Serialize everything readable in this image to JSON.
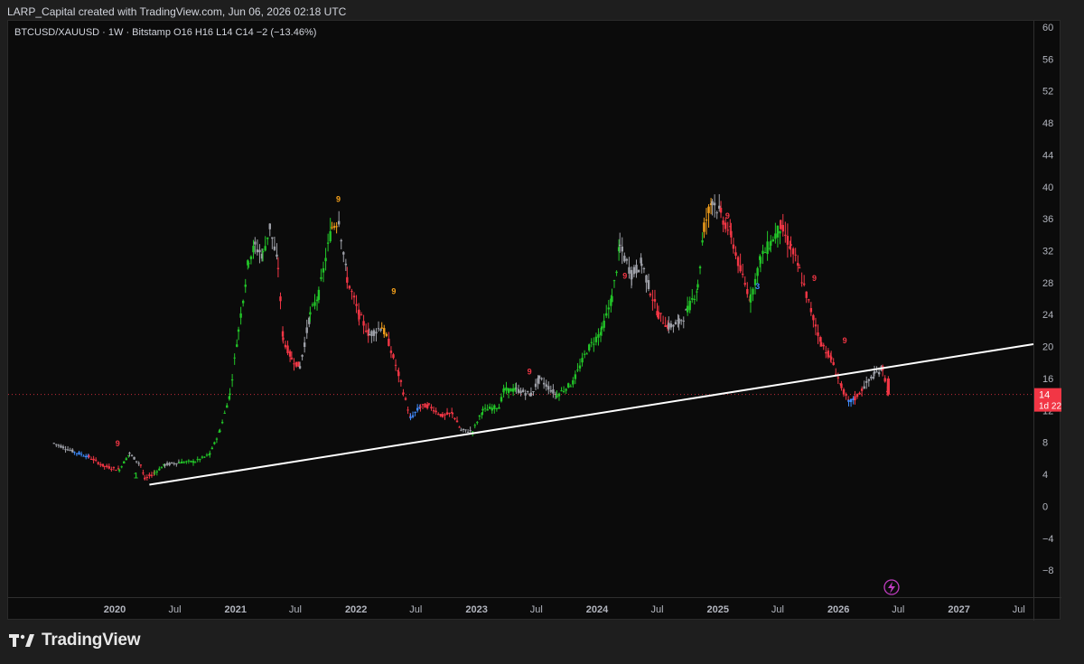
{
  "header": {
    "attribution": "LARP_Capital created with TradingView.com, Jun 06, 2026 02:18 UTC"
  },
  "symbol_line": "BTCUSD/XAUUSD · 1W · Bitstamp  O16  H16  L14  C14  −2 (−13.46%)",
  "brand": {
    "logo_icon": "tradingview-logo-icon",
    "name": "TradingView"
  },
  "price_badge": {
    "price": "14",
    "countdown": "1d 22h",
    "color": "#f23645"
  },
  "colors": {
    "background": "#0b0b0b",
    "up": "#22c528",
    "down": "#f23645",
    "neutral": "#9ea0a8",
    "blue": "#3d8bfd",
    "orange": "#f7a21b",
    "trendline": "#ffffff",
    "price_line": "#f23645"
  },
  "flash_icon": "lightning-icon",
  "chart_data": {
    "type": "candlestick",
    "title": "",
    "symbol": "BTCUSD/XAUUSD",
    "interval": "1W",
    "exchange": "Bitstamp",
    "y_axis": {
      "ylim": [
        -12,
        61
      ],
      "ticks": [
        "60",
        "56",
        "52",
        "48",
        "44",
        "40",
        "36",
        "32",
        "28",
        "24",
        "20",
        "16",
        "12",
        "8",
        "4",
        "0",
        "−4",
        "−8"
      ],
      "position": "right"
    },
    "x_axis": {
      "range": [
        "2019-04-01",
        "2027-08-01"
      ],
      "ticks": [
        {
          "label": "2020",
          "date": "2020-01-01",
          "bold": true
        },
        {
          "label": "Jul",
          "date": "2020-07-01",
          "bold": false
        },
        {
          "label": "2021",
          "date": "2021-01-01",
          "bold": true
        },
        {
          "label": "Jul",
          "date": "2021-07-01",
          "bold": false
        },
        {
          "label": "2022",
          "date": "2022-01-01",
          "bold": true
        },
        {
          "label": "Jul",
          "date": "2022-07-01",
          "bold": false
        },
        {
          "label": "2023",
          "date": "2023-01-01",
          "bold": true
        },
        {
          "label": "Jul",
          "date": "2023-07-01",
          "bold": false
        },
        {
          "label": "2024",
          "date": "2024-01-01",
          "bold": true
        },
        {
          "label": "Jul",
          "date": "2024-07-01",
          "bold": false
        },
        {
          "label": "2025",
          "date": "2025-01-01",
          "bold": true
        },
        {
          "label": "Jul",
          "date": "2025-07-01",
          "bold": false
        },
        {
          "label": "2026",
          "date": "2026-01-01",
          "bold": true
        },
        {
          "label": "Jul",
          "date": "2026-07-01",
          "bold": false
        },
        {
          "label": "2027",
          "date": "2027-01-01",
          "bold": true
        },
        {
          "label": "Jul",
          "date": "2027-07-01",
          "bold": false
        }
      ]
    },
    "trendline": {
      "start": [
        "2020-04-15",
        2.7
      ],
      "end": [
        "2027-08-01",
        20.3
      ]
    },
    "current_price": 14,
    "price_path": [
      [
        "2019-07-01",
        7.9,
        "neutral"
      ],
      [
        "2019-09-01",
        6.8,
        "neutral"
      ],
      [
        "2019-10-15",
        6.2,
        "blue"
      ],
      [
        "2019-12-01",
        5.0,
        "down"
      ],
      [
        "2020-01-15",
        4.6,
        "down"
      ],
      [
        "2020-02-15",
        6.6,
        "up"
      ],
      [
        "2020-03-20",
        5.2,
        "neutral"
      ],
      [
        "2020-04-01",
        3.4,
        "down"
      ],
      [
        "2020-05-01",
        4.2,
        "down"
      ],
      [
        "2020-06-01",
        5.2,
        "up"
      ],
      [
        "2020-07-15",
        5.5,
        "neutral"
      ],
      [
        "2020-09-01",
        5.6,
        "up"
      ],
      [
        "2020-10-15",
        6.5,
        "up"
      ],
      [
        "2020-11-15",
        9.5,
        "up"
      ],
      [
        "2020-12-15",
        14.0,
        "up"
      ],
      [
        "2021-01-10",
        22.0,
        "up"
      ],
      [
        "2021-02-10",
        31.0,
        "up"
      ],
      [
        "2021-03-01",
        32.5,
        "up"
      ],
      [
        "2021-03-25",
        31.5,
        "neutral"
      ],
      [
        "2021-04-15",
        35.0,
        "up"
      ],
      [
        "2021-05-10",
        30.0,
        "neutral"
      ],
      [
        "2021-05-25",
        21.0,
        "down"
      ],
      [
        "2021-06-20",
        18.5,
        "down"
      ],
      [
        "2021-07-15",
        17.5,
        "down"
      ],
      [
        "2021-08-15",
        24.0,
        "neutral"
      ],
      [
        "2021-09-10",
        26.5,
        "up"
      ],
      [
        "2021-10-01",
        31.0,
        "up"
      ],
      [
        "2021-10-20",
        35.0,
        "up"
      ],
      [
        "2021-11-10",
        36.0,
        "orange"
      ],
      [
        "2021-12-05",
        28.5,
        "neutral"
      ],
      [
        "2022-01-10",
        24.0,
        "down"
      ],
      [
        "2022-02-10",
        21.5,
        "down"
      ],
      [
        "2022-03-20",
        22.5,
        "neutral"
      ],
      [
        "2022-04-10",
        20.5,
        "orange"
      ],
      [
        "2022-05-10",
        16.5,
        "down"
      ],
      [
        "2022-06-15",
        11.0,
        "down"
      ],
      [
        "2022-07-15",
        12.5,
        "blue"
      ],
      [
        "2022-08-10",
        12.6,
        "down"
      ],
      [
        "2022-09-20",
        11.3,
        "down"
      ],
      [
        "2022-10-20",
        11.7,
        "down"
      ],
      [
        "2022-11-15",
        9.5,
        "down"
      ],
      [
        "2022-12-20",
        9.4,
        "neutral"
      ],
      [
        "2023-01-20",
        12.0,
        "up"
      ],
      [
        "2023-03-10",
        12.5,
        "up"
      ],
      [
        "2023-03-25",
        14.5,
        "up"
      ],
      [
        "2023-05-01",
        14.6,
        "up"
      ],
      [
        "2023-06-15",
        14.0,
        "neutral"
      ],
      [
        "2023-07-10",
        16.0,
        "neutral"
      ],
      [
        "2023-09-01",
        13.9,
        "neutral"
      ],
      [
        "2023-10-20",
        15.5,
        "up"
      ],
      [
        "2023-12-01, 19.5",
        19.5,
        "up"
      ],
      [
        "2024-01-15",
        22.0,
        "up"
      ],
      [
        "2024-02-15",
        26.0,
        "up"
      ],
      [
        "2024-03-10",
        32.5,
        "up"
      ],
      [
        "2024-04-15",
        29.0,
        "neutral"
      ],
      [
        "2024-05-15",
        30.5,
        "neutral"
      ],
      [
        "2024-06-10",
        27.0,
        "neutral"
      ],
      [
        "2024-07-05",
        24.0,
        "down"
      ],
      [
        "2024-08-05",
        22.5,
        "down"
      ],
      [
        "2024-09-05",
        23.0,
        "neutral"
      ],
      [
        "2024-10-01",
        24.5,
        "neutral"
      ],
      [
        "2024-11-01",
        27.5,
        "up"
      ],
      [
        "2024-11-20",
        35.0,
        "up"
      ],
      [
        "2024-12-15",
        38.5,
        "orange"
      ],
      [
        "2025-01-10",
        36.5,
        "neutral"
      ],
      [
        "2025-02-10",
        34.0,
        "down"
      ],
      [
        "2025-03-10",
        29.5,
        "down"
      ],
      [
        "2025-04-10",
        26.0,
        "down"
      ],
      [
        "2025-05-10",
        31.0,
        "up"
      ],
      [
        "2025-06-10",
        33.0,
        "up"
      ],
      [
        "2025-07-10",
        35.0,
        "up"
      ],
      [
        "2025-08-10",
        32.5,
        "down"
      ],
      [
        "2025-09-05",
        29.5,
        "down"
      ],
      [
        "2025-10-10",
        24.5,
        "down"
      ],
      [
        "2025-11-10",
        20.5,
        "down"
      ],
      [
        "2025-12-10",
        18.5,
        "down"
      ],
      [
        "2026-01-10",
        15.0,
        "down"
      ],
      [
        "2026-02-01",
        13.0,
        "down"
      ],
      [
        "2026-02-20",
        13.5,
        "blue"
      ],
      [
        "2026-03-20",
        15.0,
        "down"
      ],
      [
        "2026-04-20",
        16.5,
        "neutral"
      ],
      [
        "2026-05-15",
        17.3,
        "neutral"
      ],
      [
        "2026-06-01",
        14.0,
        "down"
      ]
    ],
    "markers": [
      {
        "date": "2020-01-10",
        "y": 7.5,
        "text": "9",
        "color": "down"
      },
      {
        "date": "2020-03-05",
        "y": 3.5,
        "text": "1",
        "color": "up"
      },
      {
        "date": "2021-11-08",
        "y": 38.1,
        "text": "9",
        "color": "orange"
      },
      {
        "date": "2022-04-25",
        "y": 26.6,
        "text": "9",
        "color": "orange"
      },
      {
        "date": "2023-06-10",
        "y": 16.5,
        "text": "9",
        "color": "down"
      },
      {
        "date": "2024-03-25",
        "y": 28.5,
        "text": "9",
        "color": "down"
      },
      {
        "date": "2025-01-30",
        "y": 36.0,
        "text": "9",
        "color": "down"
      },
      {
        "date": "2025-05-01",
        "y": 27.2,
        "text": "3",
        "color": "blue"
      },
      {
        "date": "2025-10-20",
        "y": 28.2,
        "text": "9",
        "color": "down"
      },
      {
        "date": "2026-01-20",
        "y": 20.4,
        "text": "9",
        "color": "down"
      }
    ]
  }
}
